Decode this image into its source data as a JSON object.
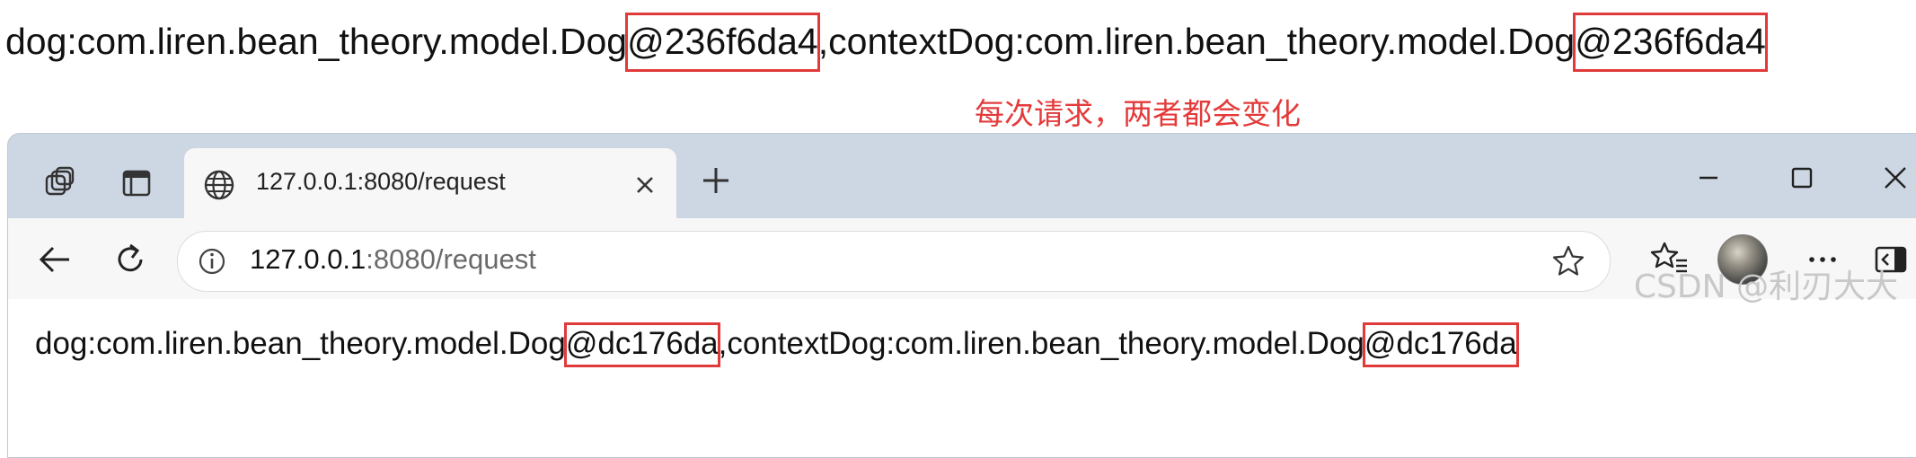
{
  "console_output": {
    "prefix": "dog:com.liren.bean_theory.model.Dog",
    "id1": "@236f6da4",
    "middle": ",contextDog:com.liren.bean_theory.model.Dog",
    "id2": "@236f6da4"
  },
  "annotation": "每次请求，两者都会变化",
  "browser": {
    "tab": {
      "title": "127.0.0.1:8080/request",
      "favicon": "globe-icon"
    },
    "address": {
      "host": "127.0.0.1",
      "path": ":8080/request"
    },
    "icons": {
      "workspaces": "workspaces-icon",
      "tab_actions": "tab-actions-icon",
      "new_tab": "plus-icon",
      "minimize": "minimize-icon",
      "maximize": "maximize-icon",
      "close": "close-icon",
      "back": "back-arrow-icon",
      "refresh": "refresh-icon",
      "site_info": "info-icon",
      "favorite": "star-icon",
      "favorites": "favorites-list-icon",
      "profile": "avatar",
      "more": "more-icon",
      "sidebar": "sidebar-toggle-icon"
    }
  },
  "page_output": {
    "prefix": "dog:com.liren.bean_theory.model.Dog",
    "id1": "@dc176da",
    "middle": ",contextDog:com.liren.bean_theory.model.Dog",
    "id2": "@dc176da"
  },
  "watermark": "CSDN @利刃大大",
  "colors": {
    "highlight": "#e03a3a",
    "annotation": "#e43a3a",
    "tabstrip": "#cdd6e3"
  }
}
